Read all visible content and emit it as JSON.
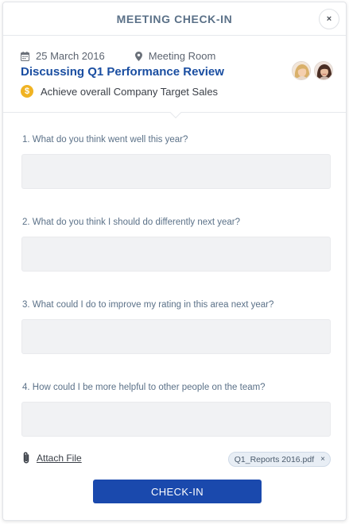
{
  "modal": {
    "title": "MEETING CHECK-IN",
    "close_label": "×"
  },
  "meeting": {
    "date": "25 March 2016",
    "location": "Meeting Room",
    "title": "Discussing Q1 Performance Review",
    "goal_icon": "$",
    "goal": "Achieve overall Company Target Sales",
    "participants": [
      {
        "icon": "avatar-woman-blonde"
      },
      {
        "icon": "avatar-woman-dark-hair"
      }
    ]
  },
  "questions": [
    {
      "label": "1. What do you think went well this year?",
      "answer": ""
    },
    {
      "label": "2. What do you think I should do differently next year?",
      "answer": ""
    },
    {
      "label": "3. What could I do to improve my rating in this area next year?",
      "answer": ""
    },
    {
      "label": "4. How could I be more helpful to other people on the team?",
      "answer": ""
    }
  ],
  "attachment": {
    "attach_label": "Attach File",
    "file_name": "Q1_Reports 2016.pdf",
    "remove_label": "×"
  },
  "actions": {
    "checkin_label": "CHECK-IN"
  },
  "colors": {
    "accent": "#1a49ad",
    "title_link": "#1a4ea1",
    "coin": "#f0b323",
    "field_bg": "#f1f2f4"
  }
}
